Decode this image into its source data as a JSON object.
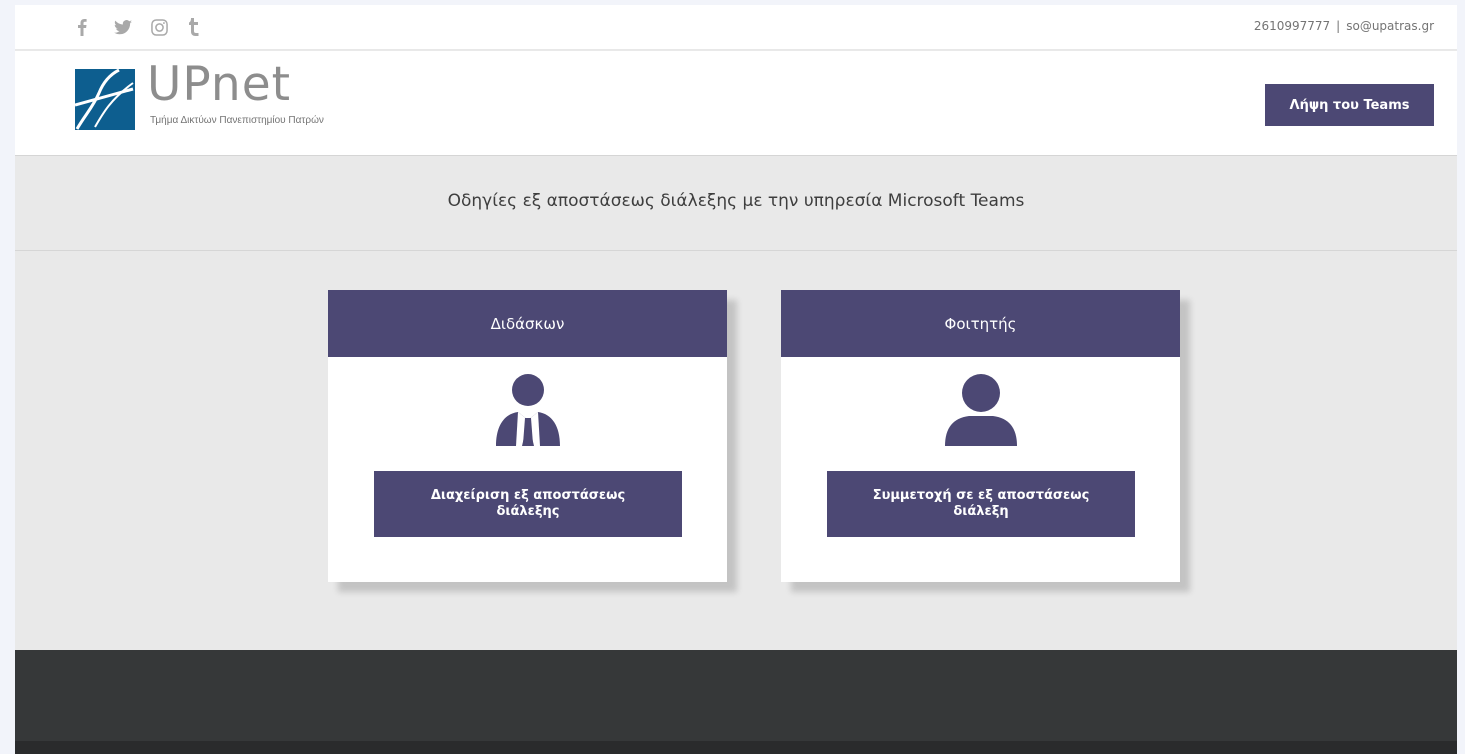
{
  "topbar": {
    "social": [
      {
        "name": "facebook-icon"
      },
      {
        "name": "twitter-icon"
      },
      {
        "name": "instagram-icon"
      },
      {
        "name": "tumblr-icon"
      }
    ],
    "phone": "2610997777",
    "separator": "|",
    "email": "so@upatras.gr"
  },
  "header": {
    "logo_name": "UPnet",
    "logo_subtitle": "Τμήμα Δικτύων Πανεπιστημίου Πατρών",
    "teams_button": "Λήψη του Teams"
  },
  "main": {
    "title": "Οδηγίες εξ αποστάσεως διάλεξης με την υπηρεσία Microsoft Teams",
    "cards": [
      {
        "heading": "Διδάσκων",
        "icon": "teacher-icon",
        "button": "Διαχείριση εξ αποστάσεως διάλεξης"
      },
      {
        "heading": "Φοιτητής",
        "icon": "student-icon",
        "button": "Συμμετοχή σε εξ αποστάσεως διάλεξη"
      }
    ]
  },
  "colors": {
    "accent": "#4c4874",
    "background": "#e9e9e9",
    "footer": "#363839"
  }
}
